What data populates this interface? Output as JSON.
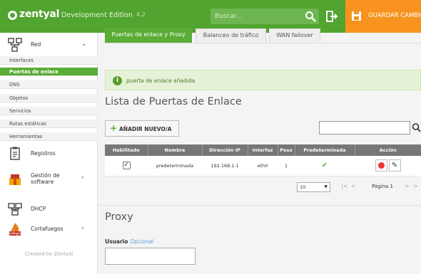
{
  "header": {
    "brand": "zentyal",
    "edition": "Development Edition",
    "version": "4.2",
    "search_placeholder": "Buscar...",
    "save_label": "GUARDAR CAMBIOS",
    "bar_color": "#51a42f",
    "save_color": "#f7931e"
  },
  "sidebar": {
    "groups": [
      {
        "label": "Red",
        "icon": "network-icon"
      },
      {
        "label": "Registros",
        "icon": "logs-icon"
      },
      {
        "label": "Gestión de software",
        "icon": "software-icon"
      },
      {
        "label": "DHCP",
        "icon": "dhcp-icon"
      },
      {
        "label": "Cortafuegos",
        "icon": "firewall-icon"
      }
    ],
    "subitems": [
      "Interfaces",
      "Puertas de enlace",
      "DNS",
      "Objetos",
      "Servicios",
      "Rutas estáticas",
      "Herramientas"
    ],
    "active_subitem": "Puertas de enlace",
    "credit": "Created by Zentyal"
  },
  "tabs": [
    {
      "label": "Puertas de enlace y Proxy",
      "active": true
    },
    {
      "label": "Balanceo de tráfico",
      "active": false
    },
    {
      "label": "WAN failover",
      "active": false
    }
  ],
  "notice": {
    "text": "puerta de enlace añadida",
    "icon": "info-icon"
  },
  "gateways": {
    "title": "Lista de Puertas de Enlace",
    "add_label": "AÑADIR NUEVO/A",
    "columns": [
      "Habilitado",
      "Nombre",
      "Dirección IP",
      "Interfaz",
      "Peso",
      "Predeterminada",
      "Acción"
    ],
    "rows": [
      {
        "enabled": "✓",
        "name": "predeterminada",
        "ip": "192.168.1.1",
        "interface": "eth0",
        "weight": "1",
        "default": "✔"
      }
    ],
    "page_size": "10",
    "page_label": "Página 1"
  },
  "proxy": {
    "title": "Proxy",
    "user_label": "Usuario",
    "user_optional": "Opcional"
  }
}
